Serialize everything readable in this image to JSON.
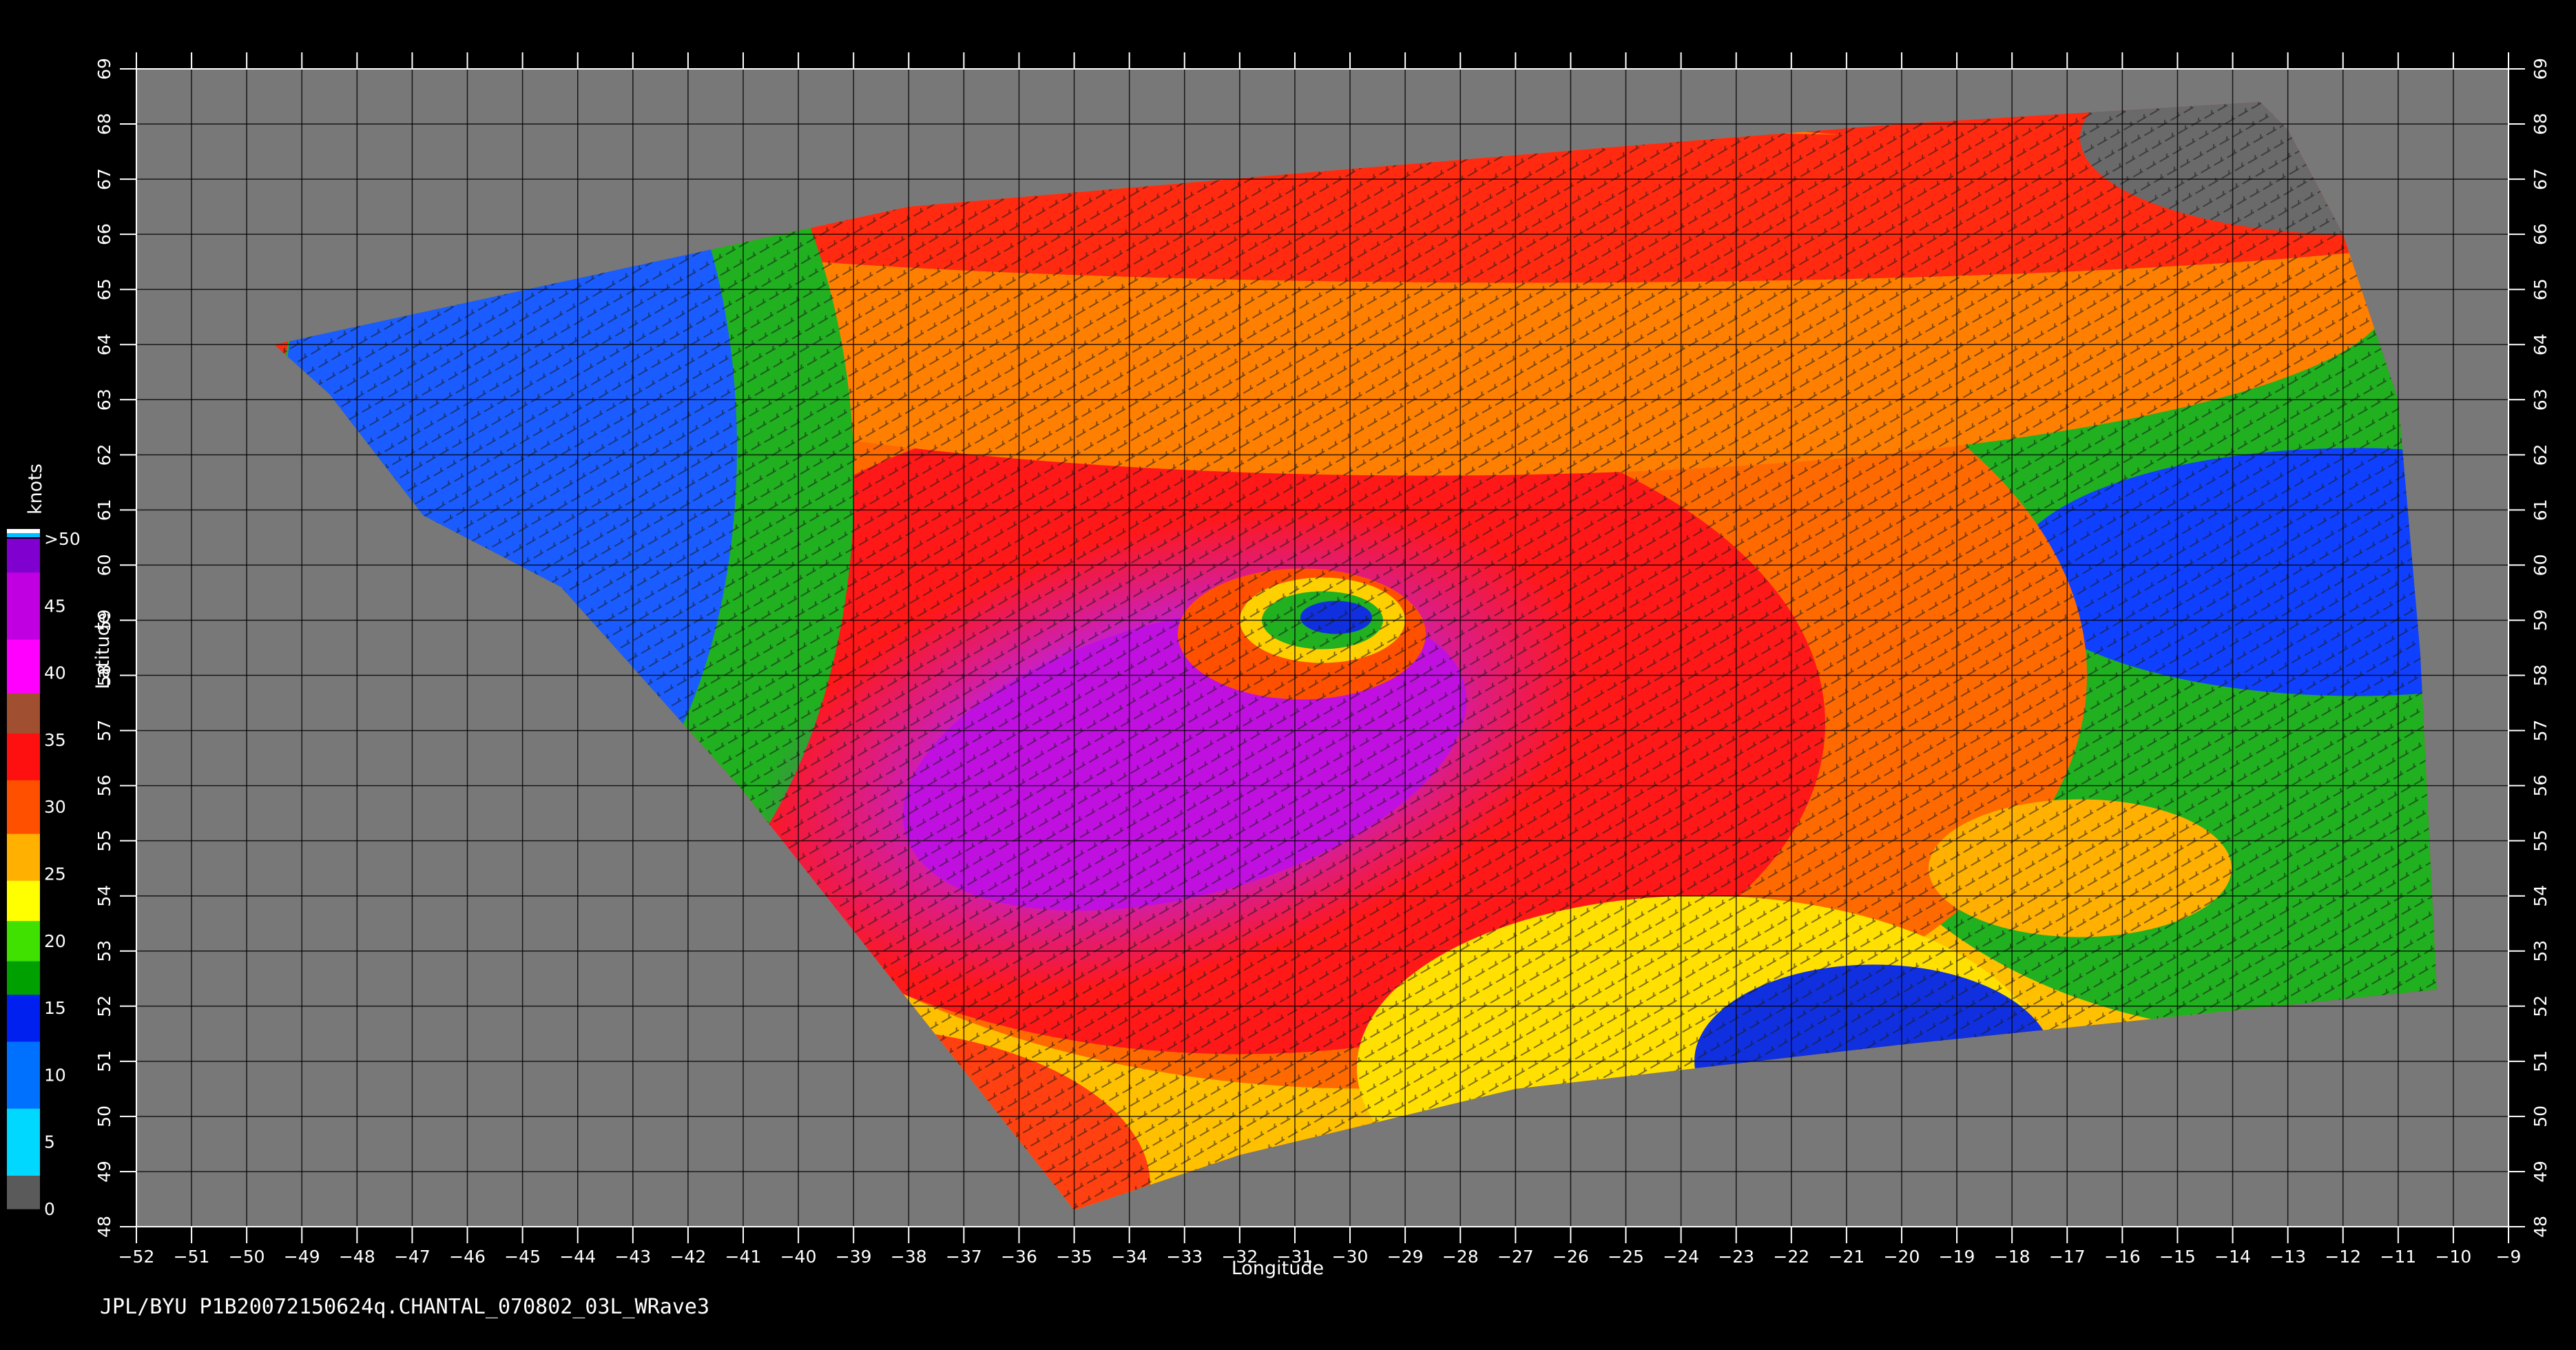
{
  "caption": "JPL/BYU  P1B20072150624q.CHANTAL_070802_03L_WRave3",
  "axes": {
    "xlabel": "Longitude",
    "ylabel": "Latitude",
    "lon_range": [
      -52,
      -9
    ],
    "lat_range": [
      48,
      69
    ],
    "lon_ticks": [
      -52,
      -51,
      -50,
      -49,
      -48,
      -47,
      -46,
      -45,
      -44,
      -43,
      -42,
      -41,
      -40,
      -39,
      -38,
      -37,
      -36,
      -35,
      -34,
      -33,
      -32,
      -31,
      -30,
      -29,
      -28,
      -27,
      -26,
      -25,
      -24,
      -23,
      -22,
      -21,
      -20,
      -19,
      -18,
      -17,
      -16,
      -15,
      -14,
      -13,
      -12,
      -11,
      -10,
      -9
    ],
    "lat_ticks": [
      48,
      49,
      50,
      51,
      52,
      53,
      54,
      55,
      56,
      57,
      58,
      59,
      60,
      61,
      62,
      63,
      64,
      65,
      66,
      67,
      68,
      69
    ],
    "grid": true
  },
  "colorbar": {
    "title": "knots",
    "labels": [
      "0",
      "5",
      "10",
      "15",
      "20",
      "25",
      "30",
      "35",
      "40",
      "45",
      ">50"
    ],
    "stops": [
      {
        "value": 0,
        "color": "#5a5a5a"
      },
      {
        "value": 5,
        "color": "#00d8ff"
      },
      {
        "value": 10,
        "color": "#0070ff"
      },
      {
        "value": 15,
        "color": "#0020f0"
      },
      {
        "value": 17,
        "color": "#00a000"
      },
      {
        "value": 20,
        "color": "#40e000"
      },
      {
        "value": 23,
        "color": "#ffff00"
      },
      {
        "value": 26,
        "color": "#ffb000"
      },
      {
        "value": 30,
        "color": "#ff5000"
      },
      {
        "value": 34,
        "color": "#ff1010"
      },
      {
        "value": 37,
        "color": "#a05030"
      },
      {
        "value": 40,
        "color": "#ff00ff"
      },
      {
        "value": 45,
        "color": "#c000e0"
      },
      {
        "value": 50,
        "color": "#8000d0"
      }
    ],
    "over_color": "#ffffff"
  },
  "map": {
    "land_color": "#787878",
    "background": "#000000",
    "storm_center": {
      "lon": -30.5,
      "lat": 59.0
    }
  }
}
